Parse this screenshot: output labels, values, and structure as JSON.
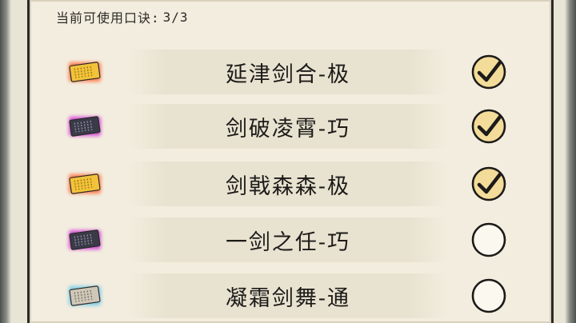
{
  "header": {
    "usage_label": "当前可使用口诀:",
    "usage_value": "3/3"
  },
  "skills": [
    {
      "name": "延津剑合-极",
      "tier": "gold",
      "selected": true
    },
    {
      "name": "剑破凌霄-巧",
      "tier": "purple",
      "selected": true
    },
    {
      "name": "剑戟森森-极",
      "tier": "gold",
      "selected": true
    },
    {
      "name": "一剑之任-巧",
      "tier": "purple",
      "selected": false
    },
    {
      "name": "凝霜剑舞-通",
      "tier": "blue",
      "selected": false
    }
  ],
  "colors": {
    "gold_fill": "#f2c23a",
    "gold_glow": "#ff6a3a",
    "purple_fill": "#3a3a48",
    "purple_glow": "#d23ad8",
    "blue_fill": "#cfc7b8",
    "blue_glow": "#6cc9e8",
    "check_fill": "#f3dc99",
    "ink": "#1c1b19"
  },
  "icons": {
    "scroll": "scroll-book-icon",
    "check_on": "checkmark-circle-icon",
    "check_off": "empty-circle-icon"
  }
}
